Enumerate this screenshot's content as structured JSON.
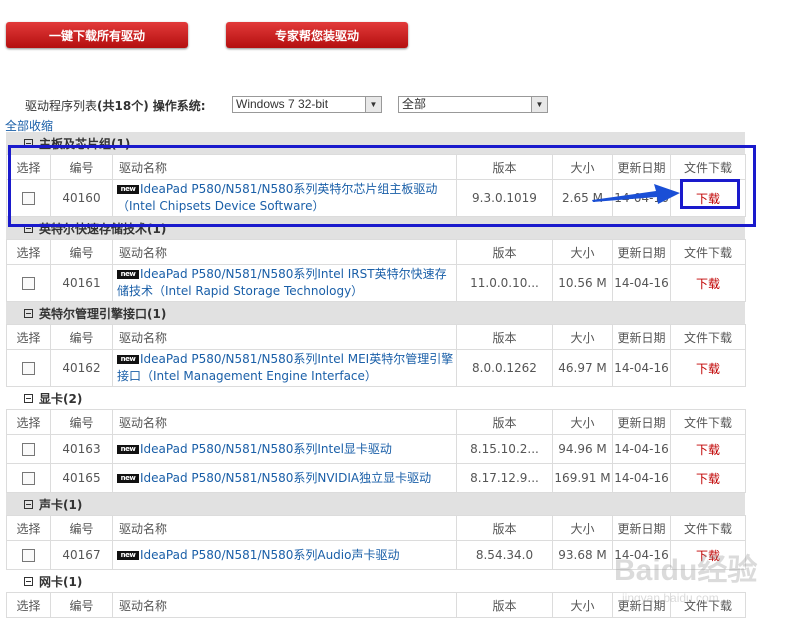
{
  "buttons": {
    "download_all": "一键下载所有驱动",
    "expert_install": "专家帮您装驱动"
  },
  "filter": {
    "label_prefix": "驱动程序列表",
    "count_text": "(共18个)",
    "os_label": "操作系统:",
    "os_value": "Windows 7 32-bit",
    "category_value": "全部"
  },
  "collapse_all": "全部收缩",
  "columns": {
    "select": "选择",
    "id": "编号",
    "name": "驱动名称",
    "version": "版本",
    "size": "大小",
    "date": "更新日期",
    "download": "文件下载"
  },
  "badge": "new",
  "categories": [
    {
      "title": "主板及芯片组(1)",
      "rows": [
        {
          "id": "40160",
          "name": "IdeaPad P580/N581/N580系列英特尔芯片组主板驱动（Intel Chipsets Device Software）",
          "version": "9.3.0.1019",
          "size": "2.65 M",
          "date": "14-04-16",
          "download": "下载"
        }
      ]
    },
    {
      "title": "英特尔快速存储技术(1)",
      "rows": [
        {
          "id": "40161",
          "name": "IdeaPad P580/N581/N580系列Intel IRST英特尔快速存储技术（Intel Rapid Storage Technology）",
          "version": "11.0.0.10...",
          "size": "10.56 M",
          "date": "14-04-16",
          "download": "下载"
        }
      ]
    },
    {
      "title": "英特尔管理引擎接口(1)",
      "rows": [
        {
          "id": "40162",
          "name": "IdeaPad P580/N581/N580系列Intel MEI英特尔管理引擎接口（Intel Management Engine Interface）",
          "version": "8.0.0.1262",
          "size": "46.97 M",
          "date": "14-04-16",
          "download": "下载"
        }
      ]
    },
    {
      "title": "显卡(2)",
      "rows": [
        {
          "id": "40163",
          "name": "IdeaPad P580/N581/N580系列Intel显卡驱动",
          "version": "8.15.10.2...",
          "size": "94.96 M",
          "date": "14-04-16",
          "download": "下载"
        },
        {
          "id": "40165",
          "name": "IdeaPad P580/N581/N580系列NVIDIA独立显卡驱动",
          "version": "8.17.12.9...",
          "size": "169.91 M",
          "date": "14-04-16",
          "download": "下载"
        }
      ]
    },
    {
      "title": "声卡(1)",
      "rows": [
        {
          "id": "40167",
          "name": "IdeaPad P580/N581/N580系列Audio声卡驱动",
          "version": "8.54.34.0",
          "size": "93.68 M",
          "date": "14-04-16",
          "download": "下载"
        }
      ]
    },
    {
      "title": "网卡(1)",
      "rows": []
    }
  ],
  "watermark": {
    "line1": "Baidu经验",
    "line2": "jingyan.baidu.com"
  },
  "colors": {
    "button_red": "#c8161d",
    "link_blue": "#1a5fa8",
    "download_red": "#c00000",
    "annotation_blue": "#1a1acc",
    "category_bg": "#e1e1e1"
  }
}
